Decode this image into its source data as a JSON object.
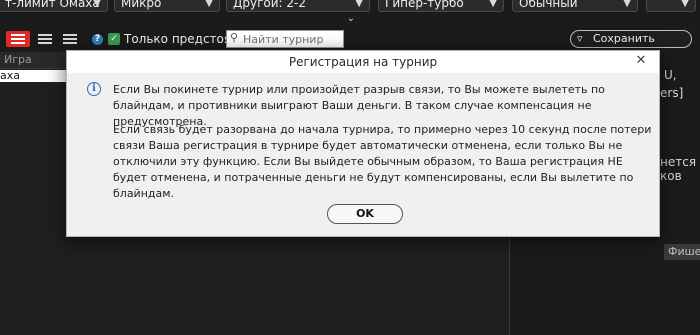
{
  "filters": [
    {
      "value": "т-лимит Омаха"
    },
    {
      "value": "Микро"
    },
    {
      "value": "Другой: 2-2"
    },
    {
      "value": "Гипер-турбо"
    },
    {
      "value": "Обычный"
    }
  ],
  "toolbar": {
    "upcoming_only_label": "Только предстоящие",
    "upcoming_only_checked": true,
    "search_placeholder": "Найти турнир",
    "save_filter_label": "Сохранить фильтр"
  },
  "table": {
    "column_header": "Игра",
    "rows": [
      {
        "game": "аха"
      }
    ]
  },
  "side_panel": {
    "fragments": [
      "U,",
      "ers]",
      "нется",
      "ков"
    ],
    "tab_label": "Фишек"
  },
  "dialog": {
    "title": "Регистрация на турнир",
    "message_paragraph_1": "Если Вы покинете турнир или произойдет разрыв связи, то Вы можете вылететь по блайндам, и противники выиграют Ваши деньги. В таком случае компенсация не предусмотрена.",
    "message_paragraph_2": "Если связь будет разорвана до начала турнира, то примерно через 10 секунд после потери связи Ваша регистрация в турнире будет автоматически отменена, если только Вы не отключили эту функцию. Если Вы выйдете обычным образом, то Ваша регистрация НЕ будет отменена, и потраченные деньги не будут компенсированы, если Вы вылетите по блайндам.",
    "ok_label": "OK"
  },
  "colors": {
    "accent_red": "#e02a2a",
    "checkbox_green": "#3c9a54",
    "info_blue": "#2b6fc3"
  }
}
